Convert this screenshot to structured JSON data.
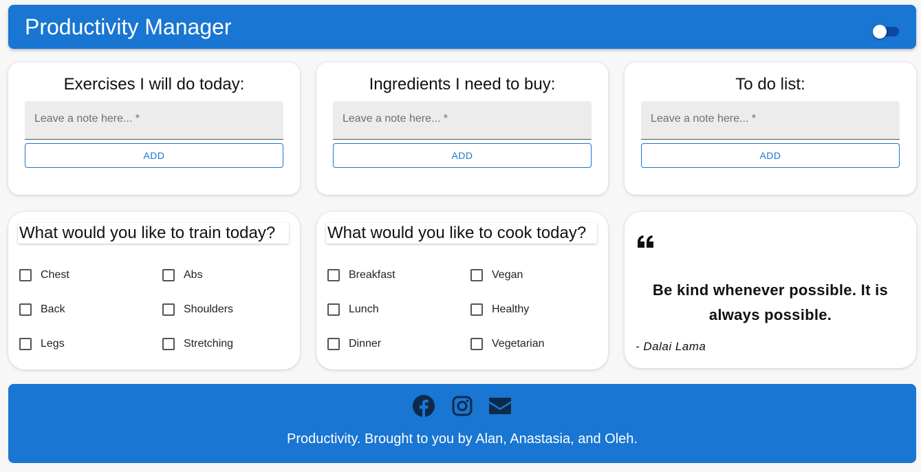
{
  "header": {
    "title": "Productivity Manager"
  },
  "note_cards": [
    {
      "heading": "Exercises I will do today:",
      "placeholder": "Leave a note here... *",
      "button": "ADD"
    },
    {
      "heading": "Ingredients I need to buy:",
      "placeholder": "Leave a note here... *",
      "button": "ADD"
    },
    {
      "heading": "To do list:",
      "placeholder": "Leave a note here... *",
      "button": "ADD"
    }
  ],
  "train": {
    "title": "What would you like to train today?",
    "options": [
      "Chest",
      "Abs",
      "Back",
      "Shoulders",
      "Legs",
      "Stretching"
    ]
  },
  "cook": {
    "title": "What would you like to cook today?",
    "options": [
      "Breakfast",
      "Vegan",
      "Lunch",
      "Healthy",
      "Dinner",
      "Vegetarian"
    ]
  },
  "quote": {
    "text": "Be kind whenever possible. It is always possible.",
    "author": "- Dalai Lama"
  },
  "footer": {
    "icons": [
      "facebook-icon",
      "instagram-icon",
      "mail-icon"
    ],
    "credit": "Productivity. Brought to you by Alan, Anastasia, and Oleh."
  },
  "colors": {
    "primary": "#1976d2",
    "background": "#f7f7f7"
  }
}
